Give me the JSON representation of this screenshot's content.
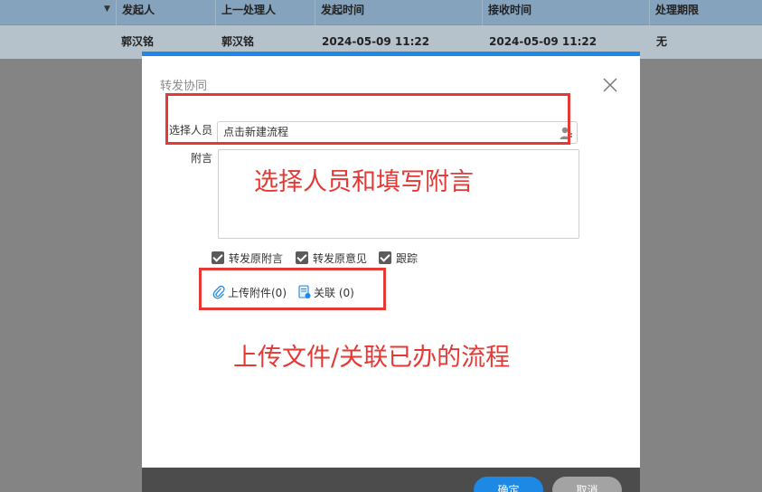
{
  "table": {
    "headers": [
      "发起人",
      "上一处理人",
      "发起时间",
      "接收时间",
      "处理期限"
    ],
    "row": [
      "郭汉铭",
      "郭汉铭",
      "2024-05-09 11:22",
      "2024-05-09 11:22",
      "无"
    ]
  },
  "dialog": {
    "title": "转发协同",
    "select_label": "选择人员",
    "select_value": "点击新建流程",
    "note_label": "附言",
    "checkboxes": [
      {
        "label": "转发原附言",
        "checked": true
      },
      {
        "label": "转发原意见",
        "checked": true
      },
      {
        "label": "跟踪",
        "checked": true
      }
    ],
    "upload_label": "上传附件(0)",
    "relate_label": "关联 (0)",
    "ok_label": "确定",
    "cancel_label": "取消"
  },
  "annotations": {
    "text1": "选择人员和填写附言",
    "text2": "上传文件/关联已办的流程",
    "color": "#e53935"
  },
  "colors": {
    "accent": "#1e88e5",
    "overlay": "#848484",
    "header": "#85a3bd"
  }
}
